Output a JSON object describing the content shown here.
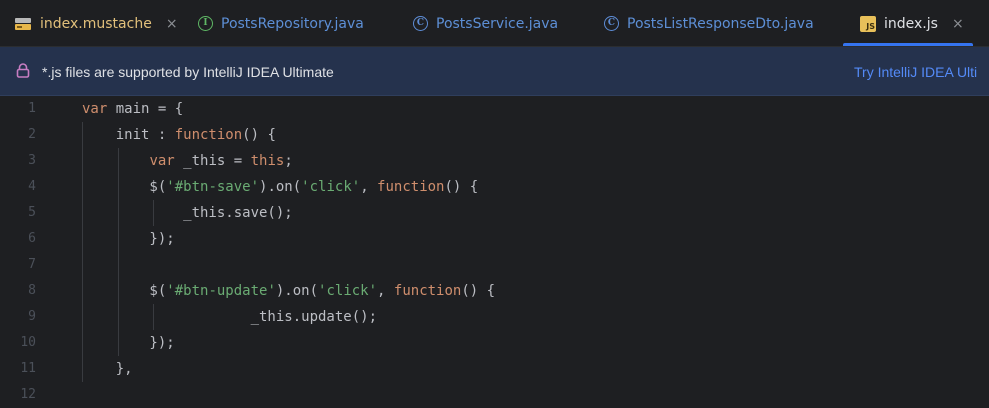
{
  "tabs": [
    {
      "label": "index.mustache",
      "icon": "mustache-template-icon",
      "closable": true,
      "active": false
    },
    {
      "label": "PostsRepository.java",
      "icon": "interface-icon",
      "closable": false,
      "active": false
    },
    {
      "label": "PostsService.java",
      "icon": "class-icon",
      "closable": false,
      "active": false
    },
    {
      "label": "PostsListResponseDto.java",
      "icon": "class-icon",
      "closable": false,
      "active": false
    },
    {
      "label": "index.js",
      "icon": "javascript-file-icon",
      "closable": true,
      "active": true
    }
  ],
  "tab_icon_glyphs": {
    "interface": "I",
    "class": "C",
    "js": "JS"
  },
  "tab_close_glyph": "×",
  "banner": {
    "icon": "lock-icon",
    "text": "*.js files are supported by IntelliJ IDEA Ultimate",
    "action": "Try IntelliJ IDEA Ulti"
  },
  "editor": {
    "line_numbers": [
      "1",
      "2",
      "3",
      "4",
      "5",
      "6",
      "7",
      "8",
      "9",
      "10",
      "11",
      "12"
    ],
    "lines": [
      "var main = {",
      "    init : function() {",
      "        var _this = this;",
      "        $('#btn-save').on('click', function() {",
      "            _this.save();",
      "        });",
      "",
      "        $('#btn-update').on('click', function() {",
      "                    _this.update();",
      "        });",
      "    },",
      ""
    ]
  },
  "colors": {
    "background": "#1e1f22",
    "banner_background": "#25324d",
    "keyword": "#cf8e6d",
    "string": "#6aab73",
    "text": "#bcbec4",
    "link": "#548af7",
    "active_tab_underline": "#3574f0"
  }
}
